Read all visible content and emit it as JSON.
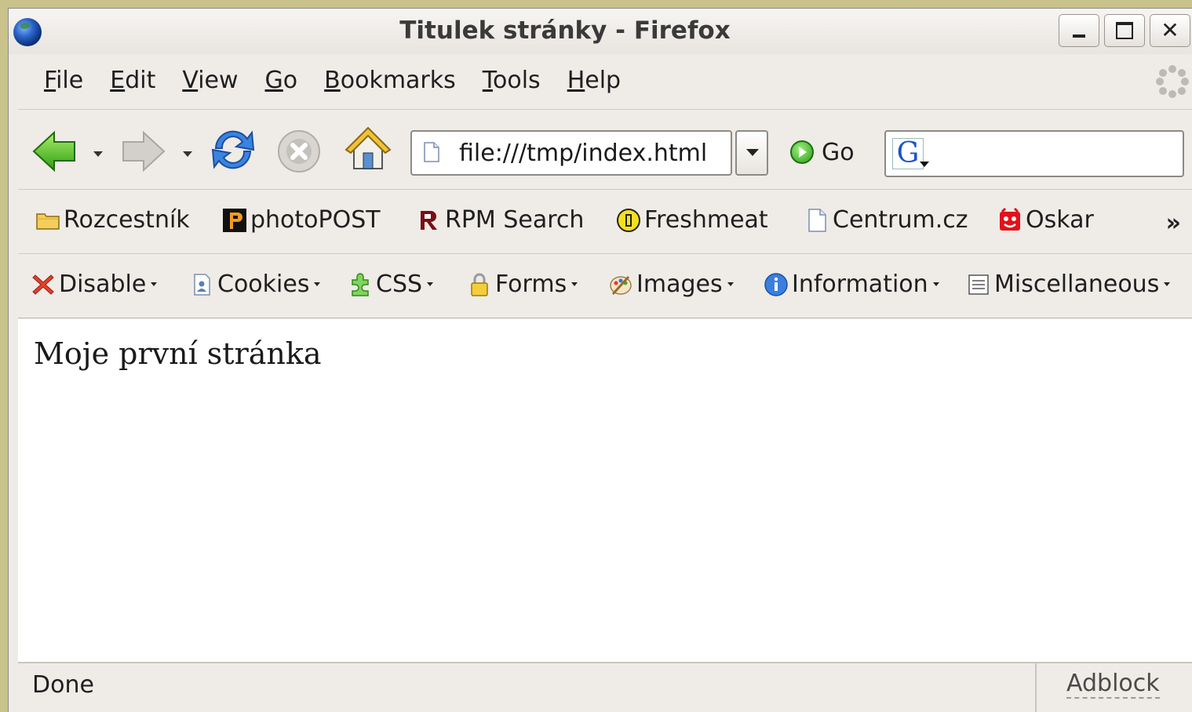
{
  "window": {
    "title": "Titulek stránky - Firefox"
  },
  "menubar": {
    "items": [
      {
        "label": "File",
        "accel": "F",
        "rest": "ile"
      },
      {
        "label": "Edit",
        "accel": "E",
        "rest": "dit"
      },
      {
        "label": "View",
        "accel": "V",
        "rest": "iew"
      },
      {
        "label": "Go",
        "accel": "G",
        "rest": "o"
      },
      {
        "label": "Bookmarks",
        "accel": "B",
        "rest": "ookmarks"
      },
      {
        "label": "Tools",
        "accel": "T",
        "rest": "ools"
      },
      {
        "label": "Help",
        "accel": "H",
        "rest": "elp"
      }
    ]
  },
  "navbar": {
    "url": "file:///tmp/index.html",
    "go_label": "Go",
    "search_value": ""
  },
  "bookmarks": {
    "items": [
      {
        "label": "Rozcestník",
        "icon": "folder-icon"
      },
      {
        "label": "photoPOST",
        "icon": "photopost-icon"
      },
      {
        "label": "RPM Search",
        "icon": "rpm-icon"
      },
      {
        "label": "Freshmeat",
        "icon": "freshmeat-icon"
      },
      {
        "label": "Centrum.cz",
        "icon": "page-icon"
      },
      {
        "label": "Oskar",
        "icon": "oskar-icon"
      }
    ],
    "overflow": "»"
  },
  "devbar": {
    "items": [
      {
        "label": "Disable",
        "icon": "disable-icon"
      },
      {
        "label": "Cookies",
        "icon": "cookies-icon"
      },
      {
        "label": "CSS",
        "icon": "css-icon"
      },
      {
        "label": "Forms",
        "icon": "forms-icon"
      },
      {
        "label": "Images",
        "icon": "images-icon"
      },
      {
        "label": "Information",
        "icon": "information-icon"
      },
      {
        "label": "Miscellaneous",
        "icon": "miscellaneous-icon"
      }
    ]
  },
  "content": {
    "text": "Moje první stránka"
  },
  "statusbar": {
    "status": "Done",
    "adblock": "Adblock"
  },
  "colors": {
    "desktop": "#c9c28a",
    "chrome": "#efebe7",
    "content_bg": "#ffffff"
  }
}
